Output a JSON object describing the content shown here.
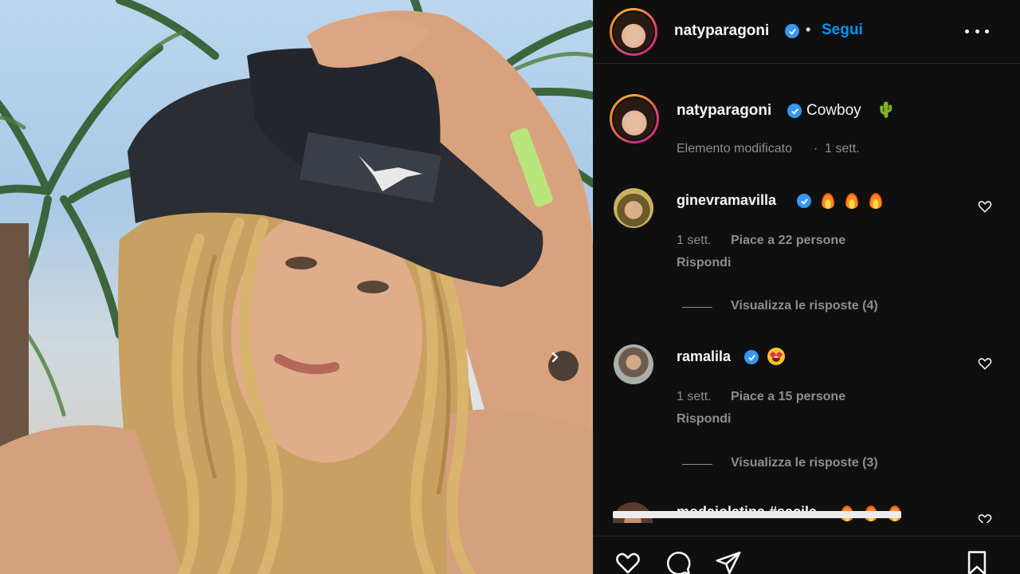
{
  "post": {
    "author": "natyparagoni",
    "follow_label": "Segui",
    "separator": "•",
    "caption": "Cowboy",
    "caption_emoji": "🌵",
    "edited_label": "Elemento modificato",
    "edited_time": "1 sett."
  },
  "comments": [
    {
      "username": "ginevramavilla",
      "time": "1 sett.",
      "likes": "Piace a 22 persone",
      "reply_label": "Rispondi",
      "view_replies": "Visualizza le risposte (4)"
    },
    {
      "username": "ramalila",
      "time": "1 sett.",
      "likes": "Piace a 15 persone",
      "reply_label": "Rispondi",
      "view_replies": "Visualizza le risposte (3)"
    },
    {
      "username": "modaiolatina #sacila"
    }
  ],
  "colors": {
    "accent": "#0095f6",
    "verified": "#3897f0",
    "panel_bg": "#0f0f0f",
    "muted_text": "#8e8e8e"
  },
  "icons": [
    "more-options-icon",
    "heart-icon",
    "comment-icon",
    "share-icon",
    "bookmark-icon",
    "next-arrow-icon",
    "verified-badge-icon"
  ]
}
